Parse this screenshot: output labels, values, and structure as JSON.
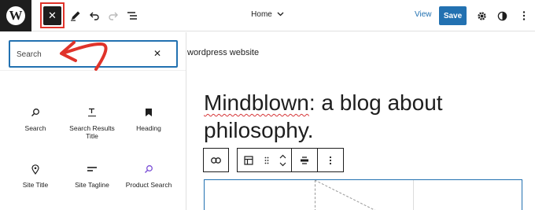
{
  "header": {
    "document_title": "Home",
    "view_label": "View",
    "save_label": "Save"
  },
  "inserter": {
    "search": {
      "placeholder": "Search",
      "value": ""
    },
    "blocks": [
      {
        "label": "Search",
        "icon": "search-icon"
      },
      {
        "label": "Search Results Title",
        "icon": "title-icon"
      },
      {
        "label": "Heading",
        "icon": "bookmark-icon"
      },
      {
        "label": "Site Title",
        "icon": "map-pin-icon"
      },
      {
        "label": "Site Tagline",
        "icon": "tagline-icon"
      },
      {
        "label": "Product Search",
        "icon": "search-icon"
      }
    ]
  },
  "canvas": {
    "site_text": "wordpress website",
    "post_title_word1": "Mindblown",
    "post_title_rest": ": a blog about philosophy."
  },
  "colors": {
    "accent": "#2271b1",
    "highlight": "#e0332a",
    "dark": "#1e1e1e",
    "product_search_icon": "#7b4fd6"
  }
}
